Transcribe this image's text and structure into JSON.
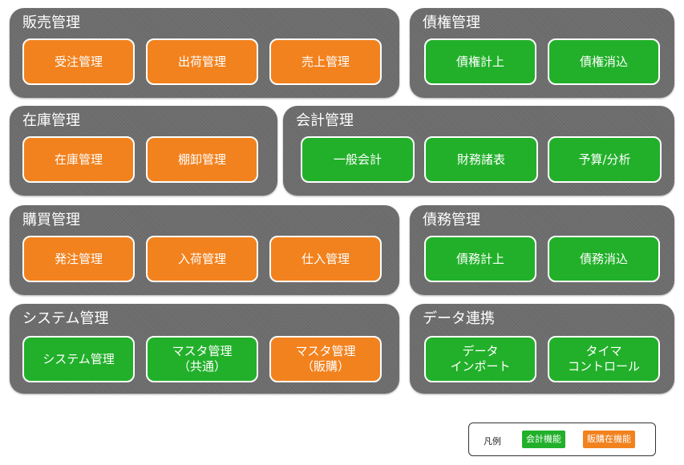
{
  "groups": {
    "sales": {
      "title": "販売管理",
      "modules": [
        "受注管理",
        "出荷管理",
        "売上管理"
      ]
    },
    "credit": {
      "title": "債権管理",
      "modules": [
        "債権計上",
        "債権消込"
      ]
    },
    "inventory": {
      "title": "在庫管理",
      "modules": [
        "在庫管理",
        "棚卸管理"
      ]
    },
    "accounting": {
      "title": "会計管理",
      "modules": [
        "一般会計",
        "財務諸表",
        "予算/分析"
      ]
    },
    "purchase": {
      "title": "購買管理",
      "modules": [
        "発注管理",
        "入荷管理",
        "仕入管理"
      ]
    },
    "debt": {
      "title": "債務管理",
      "modules": [
        "債務計上",
        "債務消込"
      ]
    },
    "system": {
      "title": "システム管理",
      "modules": [
        "システム管理",
        "マスタ管理\n（共通）",
        "マスタ管理\n（販購）"
      ]
    },
    "data": {
      "title": "データ連携",
      "modules": [
        "データ\nインポート",
        "タイマ\nコントロール"
      ]
    }
  },
  "legend": {
    "title": "凡例",
    "accounting_label": "会計機能",
    "sales_label": "販購在機能"
  },
  "colors": {
    "accounting": "#22b02a",
    "sales_purchase_inventory": "#f2821e",
    "group_bg": "#6a6a6a"
  }
}
